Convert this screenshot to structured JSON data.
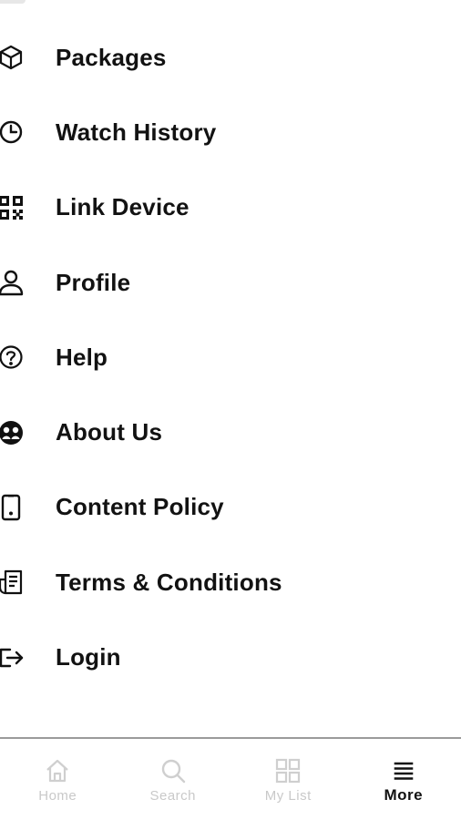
{
  "menu": {
    "items": [
      {
        "label": "Packages",
        "icon": "cube-icon"
      },
      {
        "label": "Watch History",
        "icon": "clock-icon"
      },
      {
        "label": "Link Device",
        "icon": "qr-code-icon"
      },
      {
        "label": "Profile",
        "icon": "user-icon"
      },
      {
        "label": "Help",
        "icon": "question-circle-icon"
      },
      {
        "label": "About Us",
        "icon": "about-us-icon"
      },
      {
        "label": "Content Policy",
        "icon": "phone-icon"
      },
      {
        "label": "Terms & Conditions",
        "icon": "document-icon"
      },
      {
        "label": "Login",
        "icon": "login-icon"
      }
    ]
  },
  "bottom_nav": {
    "items": [
      {
        "label": "Home",
        "icon": "home-icon",
        "active": false
      },
      {
        "label": "Search",
        "icon": "search-icon",
        "active": false
      },
      {
        "label": "My List",
        "icon": "grid-icon",
        "active": false
      },
      {
        "label": "More",
        "icon": "menu-lines-icon",
        "active": true
      }
    ]
  },
  "colors": {
    "text": "#121212",
    "inactive": "#c9c9c9",
    "divider": "#9a9a9a",
    "background": "#ffffff"
  }
}
